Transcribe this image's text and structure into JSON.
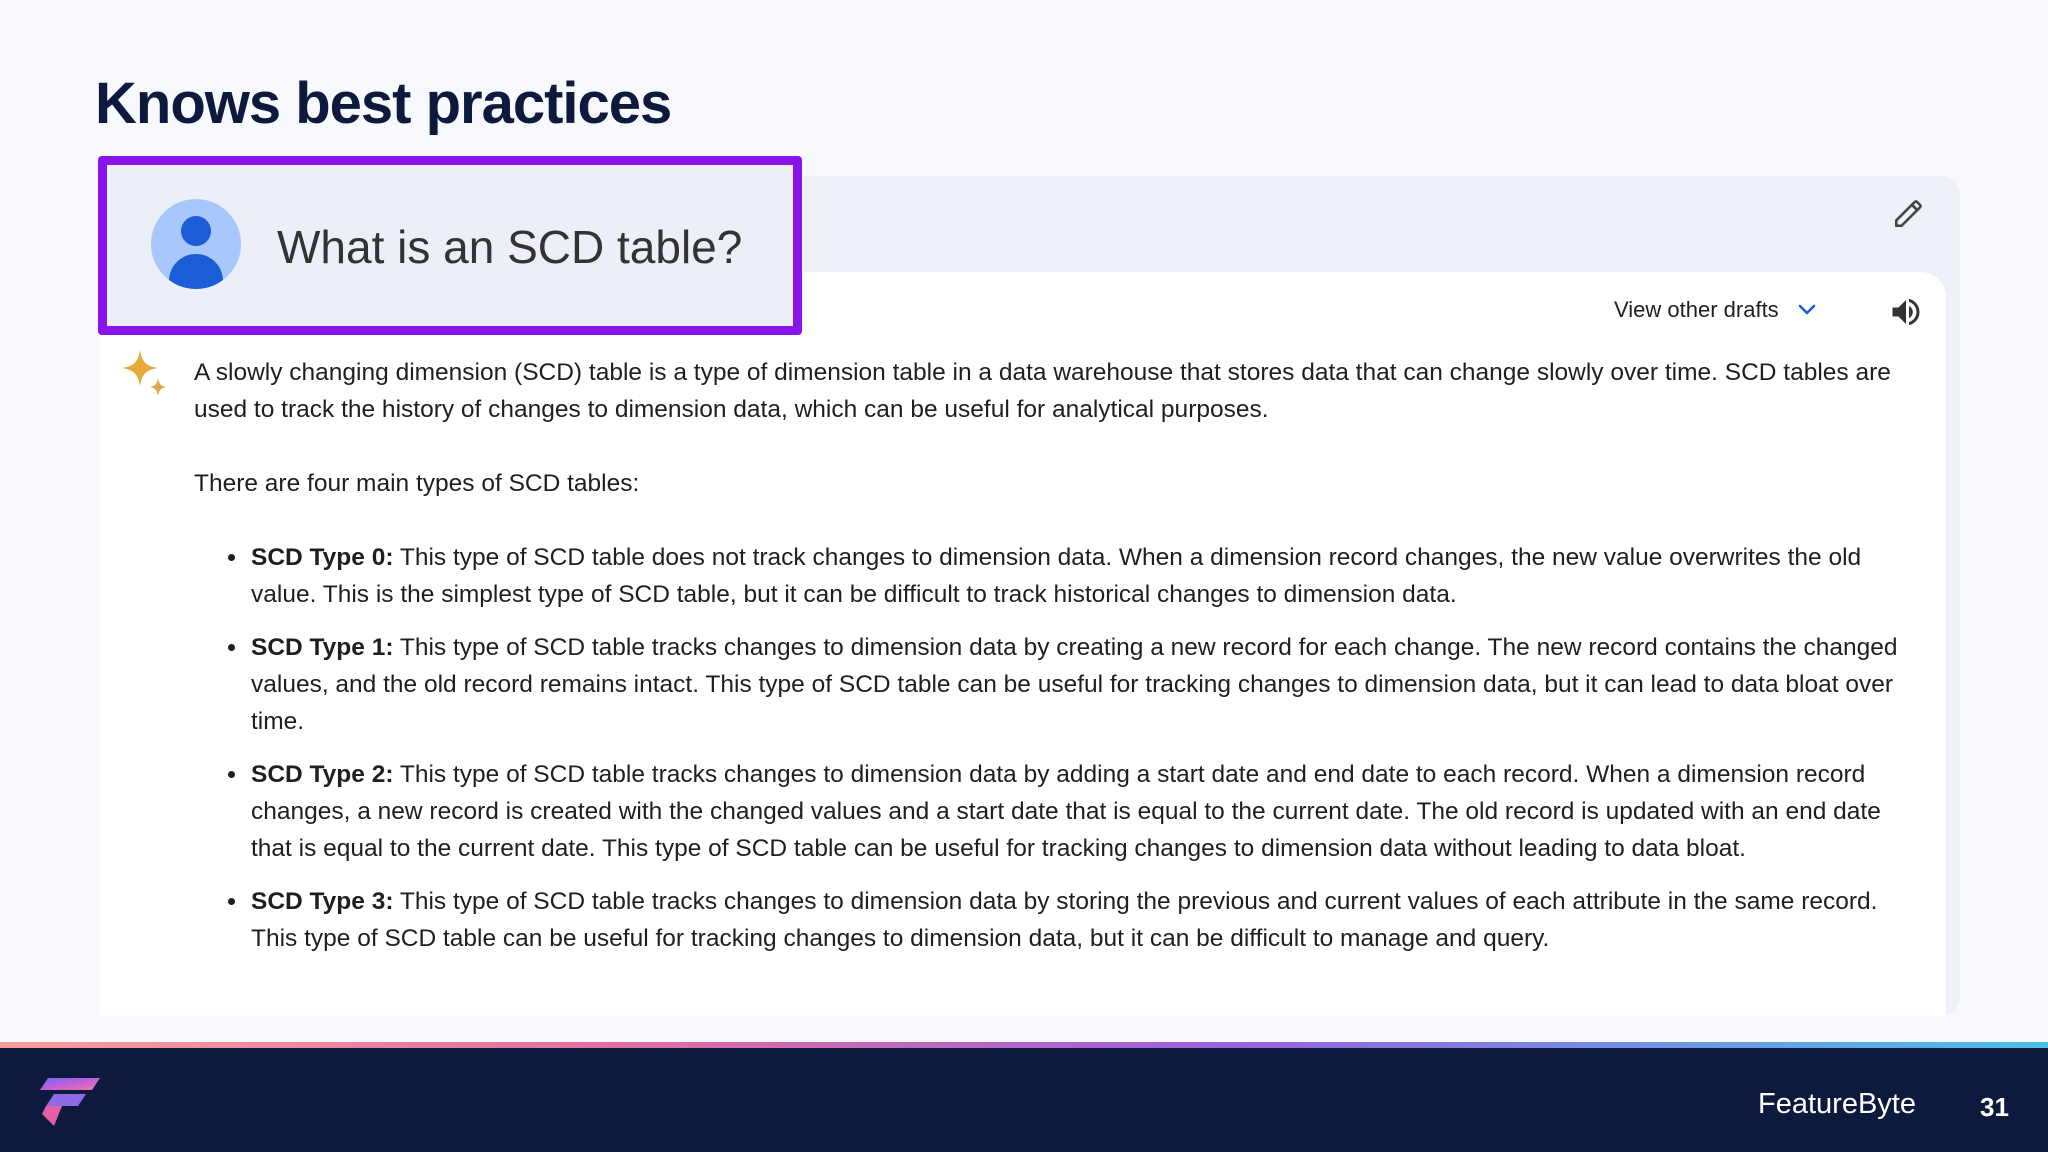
{
  "slide": {
    "title": "Knows best practices",
    "page_number": "31",
    "brand": "FeatureByte"
  },
  "prompt": {
    "text": "What is an SCD table?",
    "highlight_color": "#8a12ea"
  },
  "toolbar": {
    "view_drafts_label": "View other drafts",
    "icons": [
      "edit-icon",
      "chevron-down-icon",
      "speaker-icon",
      "gemini-sparkle-icon"
    ]
  },
  "response": {
    "intro": "A slowly changing dimension (SCD) table is a type of dimension table in a data warehouse that stores data that can change slowly over time. SCD tables are used to track the history of changes to dimension data, which can be useful for analytical purposes.",
    "lead": "There are four main types of SCD tables:",
    "items": [
      {
        "term": "SCD Type 0:",
        "text": " This type of SCD table does not track changes to dimension data. When a dimension record changes, the new value overwrites the old value. This is the simplest type of SCD table, but it can be difficult to track historical changes to dimension data."
      },
      {
        "term": "SCD Type 1:",
        "text": " This type of SCD table tracks changes to dimension data by creating a new record for each change. The new record contains the changed values, and the old record remains intact. This type of SCD table can be useful for tracking changes to dimension data, but it can lead to data bloat over time."
      },
      {
        "term": "SCD Type 2:",
        "text": " This type of SCD table tracks changes to dimension data by adding a start date and end date to each record. When a dimension record changes, a new record is created with the changed values and a start date that is equal to the current date. The old record is updated with an end date that is equal to the current date. This type of SCD table can be useful for tracking changes to dimension data without leading to data bloat."
      },
      {
        "term": "SCD Type 3:",
        "text": " This type of SCD table tracks changes to dimension data by storing the previous and current values of each attribute in the same record. This type of SCD table can be useful for tracking changes to dimension data, but it can be difficult to manage and query."
      }
    ]
  },
  "colors": {
    "title": "#0e1a3d",
    "footer_bg": "#0e1a3d",
    "accent_blue": "#1a5dd6"
  }
}
